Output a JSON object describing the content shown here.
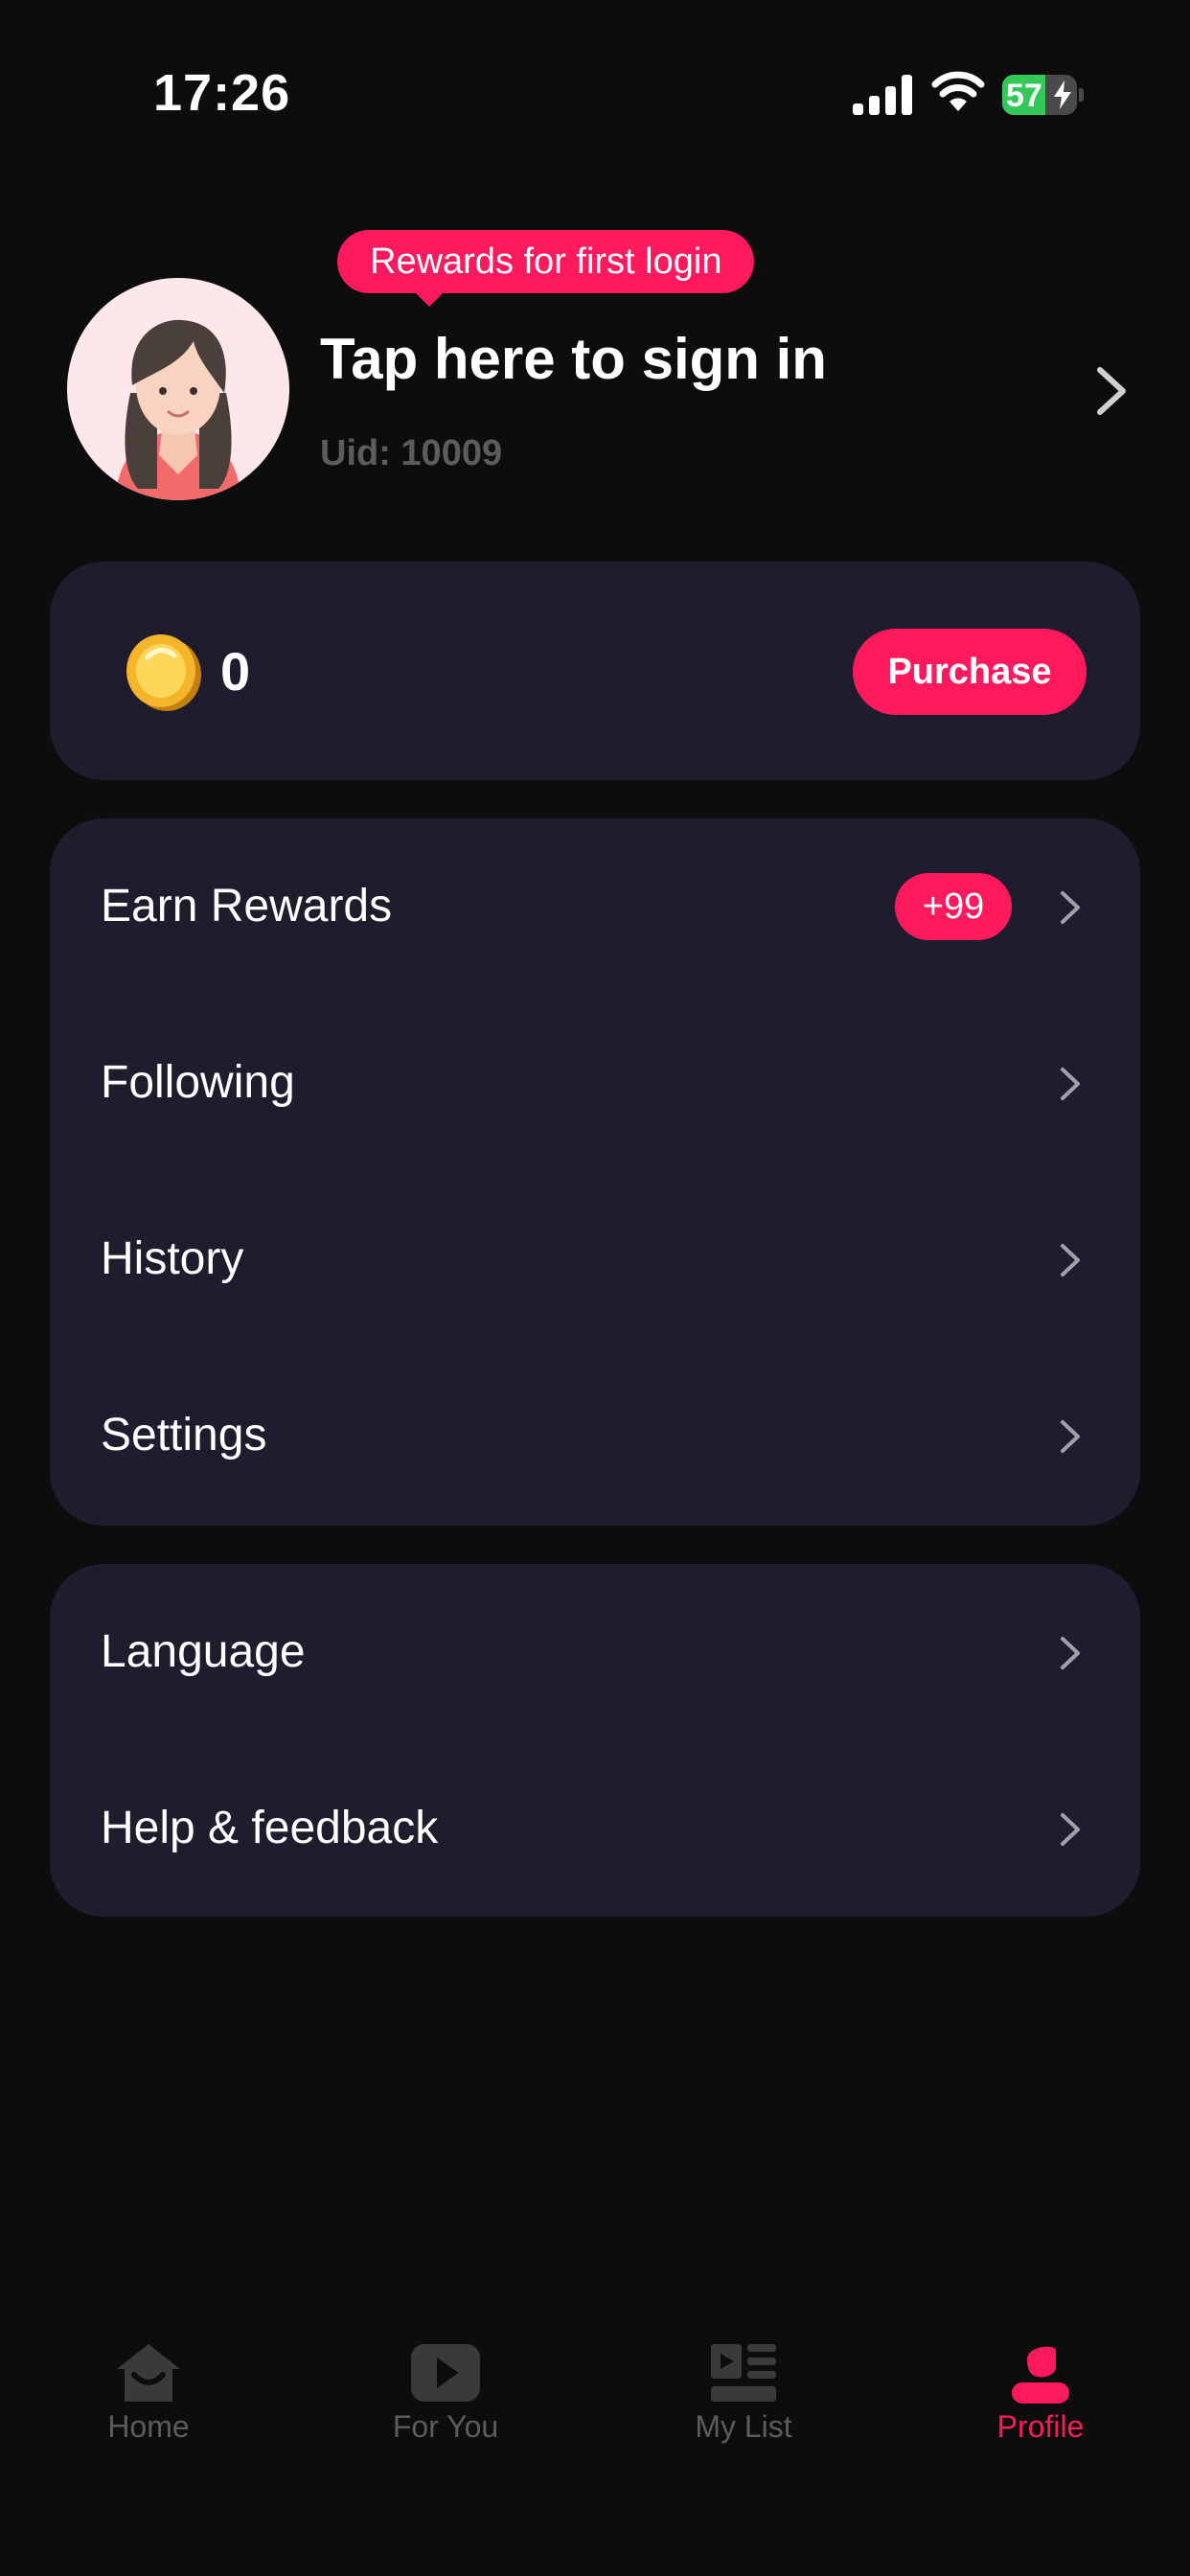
{
  "status_bar": {
    "time": "17:26",
    "battery": "57"
  },
  "header": {
    "tooltip": "Rewards for first login",
    "title": "Tap here to sign in",
    "uid": "Uid: 10009"
  },
  "wallet": {
    "coins": "0",
    "purchase_label": "Purchase"
  },
  "menu_primary": [
    {
      "label": "Earn Rewards",
      "badge": "+99"
    },
    {
      "label": "Following"
    },
    {
      "label": "History"
    },
    {
      "label": "Settings"
    }
  ],
  "menu_secondary": [
    {
      "label": "Language"
    },
    {
      "label": "Help & feedback"
    }
  ],
  "tabs": [
    {
      "label": "Home",
      "icon": "home-icon"
    },
    {
      "label": "For You",
      "icon": "play-icon"
    },
    {
      "label": "My List",
      "icon": "list-icon"
    },
    {
      "label": "Profile",
      "icon": "profile-icon",
      "active": true
    }
  ],
  "colors": {
    "accent": "#ff1a5e",
    "card": "#1f1c2d",
    "background": "#0d0d0d",
    "muted": "#5c5c5c"
  }
}
